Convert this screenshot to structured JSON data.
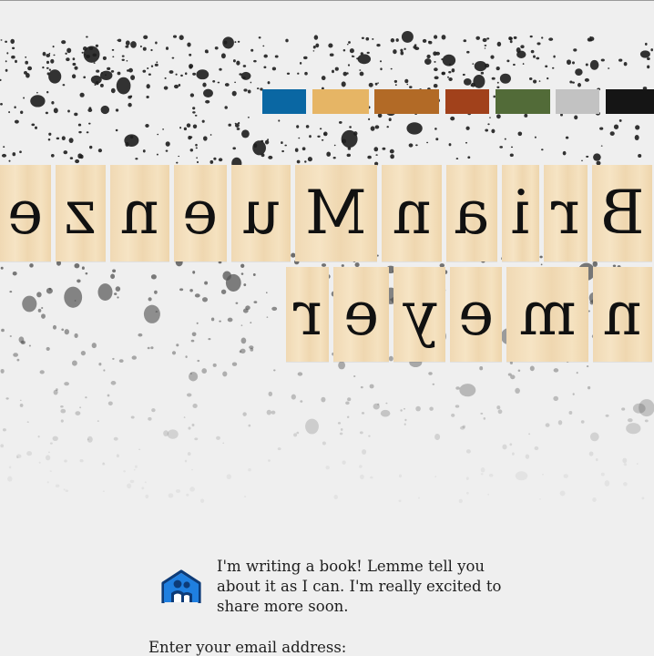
{
  "palette": {
    "swatches": [
      {
        "name": "blue",
        "color": "#0a67a3"
      },
      {
        "name": "mustard",
        "color": "#e6b565"
      },
      {
        "name": "ochre",
        "color": "#b26a26"
      },
      {
        "name": "rust",
        "color": "#a1411b"
      },
      {
        "name": "olive",
        "color": "#526b38"
      },
      {
        "name": "silver",
        "color": "#c2c2c2"
      },
      {
        "name": "black",
        "color": "#151515"
      }
    ]
  },
  "title_tiles": {
    "row1": [
      "B",
      "r",
      "i",
      "a",
      "n",
      "M",
      "u",
      "e",
      "n",
      "z",
      "e"
    ],
    "row2": [
      "n",
      "m",
      "e",
      "y",
      "e",
      "r"
    ]
  },
  "signup": {
    "logo_icon": "building-people-logo-icon",
    "intro_text": "I'm writing a book! Lemme tell you about it as I can. I'm really excited to share more soon.",
    "email_label": "Enter your email address:"
  }
}
